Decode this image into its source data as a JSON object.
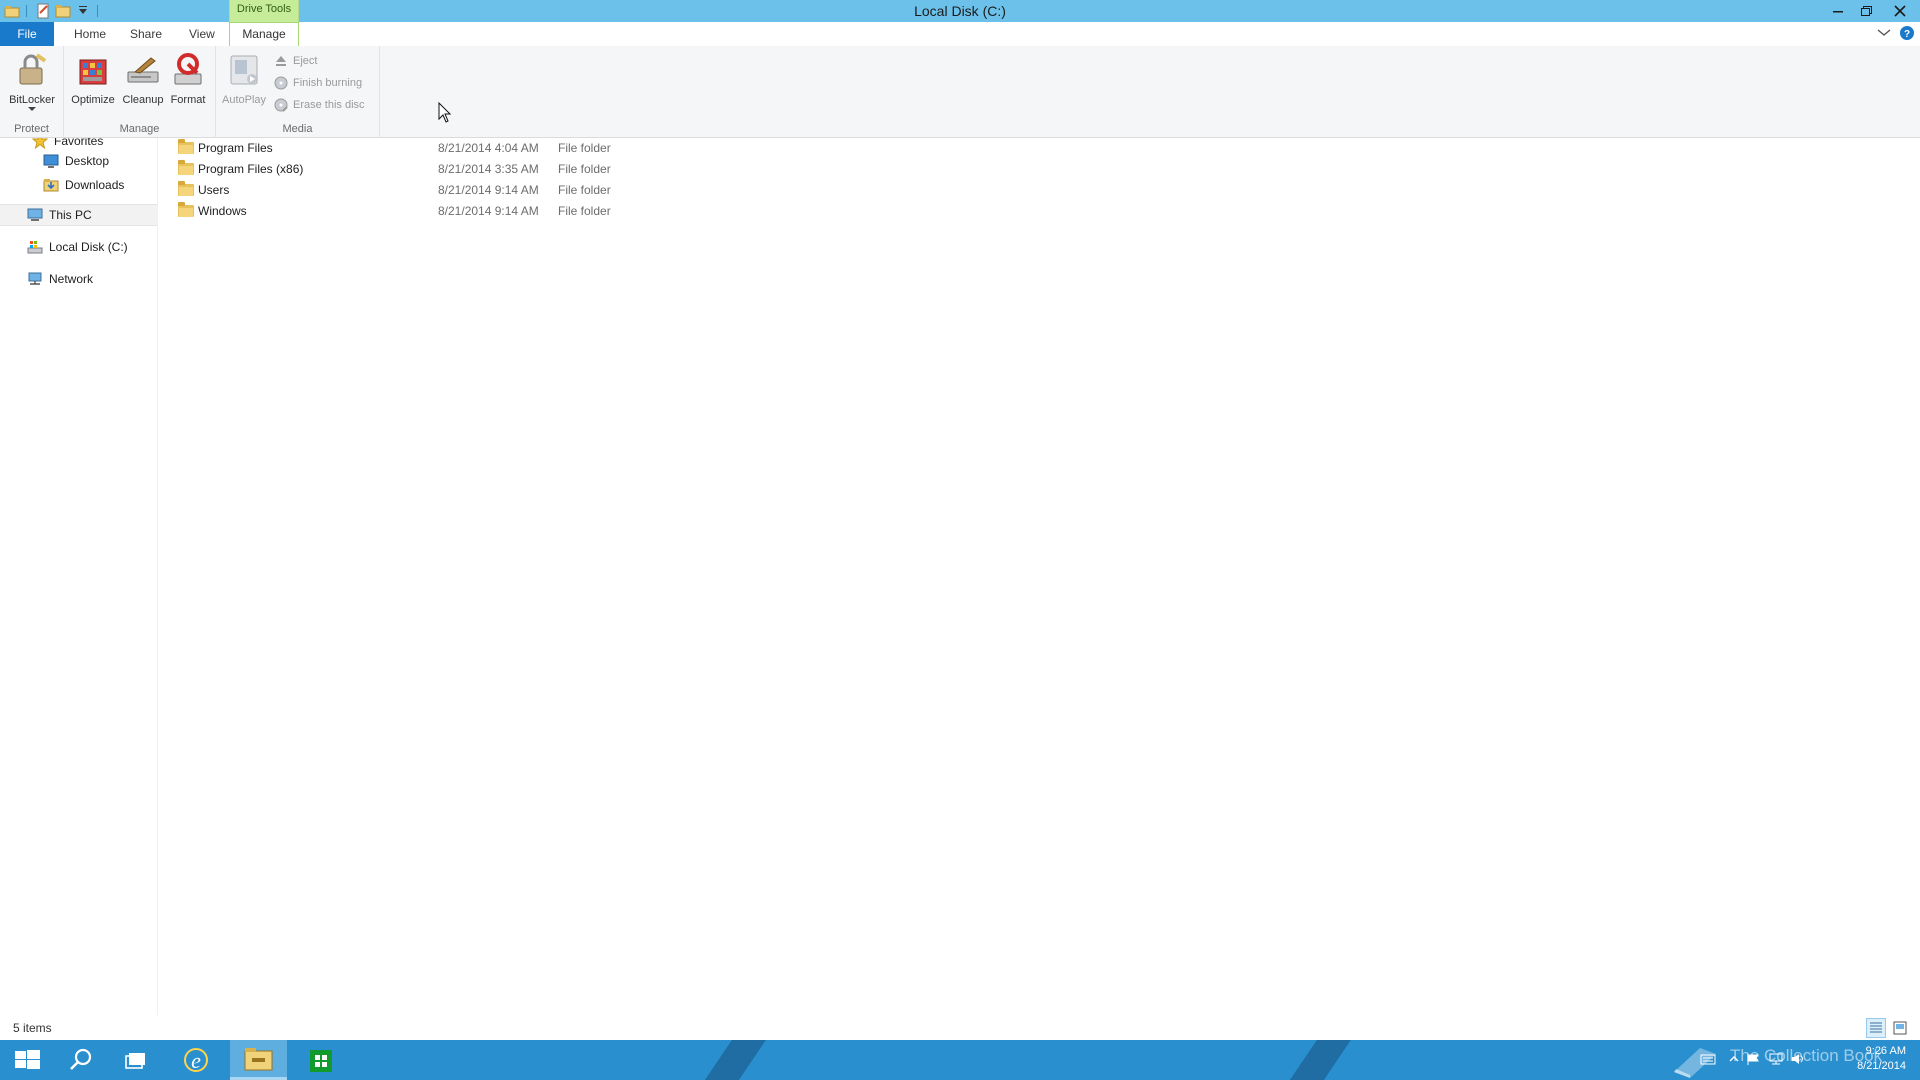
{
  "window": {
    "title": "Local Disk (C:)",
    "context_tab_group": "Drive Tools"
  },
  "tabs": [
    {
      "label": "File"
    },
    {
      "label": "Home"
    },
    {
      "label": "Share"
    },
    {
      "label": "View"
    },
    {
      "label": "Manage"
    }
  ],
  "ribbon": {
    "groups": [
      {
        "label": "Protect",
        "buttons": [
          {
            "label": "BitLocker",
            "icon": "bitlocker-icon"
          }
        ]
      },
      {
        "label": "Manage",
        "buttons": [
          {
            "label": "Optimize",
            "icon": "optimize-icon"
          },
          {
            "label": "Cleanup",
            "icon": "cleanup-icon"
          },
          {
            "label": "Format",
            "icon": "format-icon"
          }
        ]
      },
      {
        "label": "Media",
        "buttons": [
          {
            "label": "AutoPlay",
            "icon": "autoplay-icon"
          },
          {
            "label": "Eject",
            "icon": "eject-icon"
          },
          {
            "label": "Finish burning",
            "icon": "finish-burning-icon"
          },
          {
            "label": "Erase this disc",
            "icon": "erase-disc-icon"
          }
        ]
      }
    ]
  },
  "nav": {
    "items": [
      {
        "label": "Favorites"
      },
      {
        "label": "Desktop"
      },
      {
        "label": "Downloads"
      },
      {
        "label": "This PC"
      },
      {
        "label": "Local Disk (C:)"
      },
      {
        "label": "Network"
      }
    ]
  },
  "files": [
    {
      "name": "Program Files",
      "date": "8/21/2014 4:04 AM",
      "type": "File folder"
    },
    {
      "name": "Program Files (x86)",
      "date": "8/21/2014 3:35 AM",
      "type": "File folder"
    },
    {
      "name": "Users",
      "date": "8/21/2014 9:14 AM",
      "type": "File folder"
    },
    {
      "name": "Windows",
      "date": "8/21/2014 9:14 AM",
      "type": "File folder"
    }
  ],
  "status": {
    "item_count": "5 items"
  },
  "taskbar": {
    "watermark": "The Collection Book",
    "time": "9:26 AM",
    "date": "8/21/2014"
  },
  "colors": {
    "title_bar": "#6cc1ea",
    "context_tab": "#c6ec9a",
    "file_tab": "#1979ca",
    "taskbar": "#2a8fcf"
  }
}
